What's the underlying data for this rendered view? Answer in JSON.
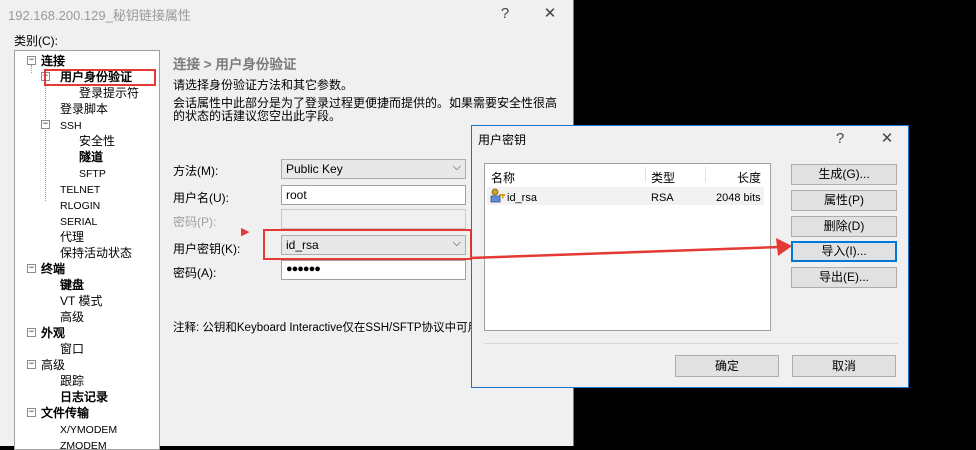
{
  "main_window": {
    "title": "192.168.200.129_秘钥链接属性",
    "help_btn": "?",
    "close_btn": "✕",
    "category_label": "类别(C):",
    "tree": {
      "connection": "连接",
      "user_auth": "用户身份验证",
      "login_prompt": "登录提示符",
      "login_script": "登录脚本",
      "ssh": "SSH",
      "security": "安全性",
      "tunnel": "隧道",
      "sftp": "SFTP",
      "telnet": "TELNET",
      "rlogin": "RLOGIN",
      "serial": "SERIAL",
      "proxy": "代理",
      "keepalive": "保持活动状态",
      "terminal": "终端",
      "keyboard": "键盘",
      "vt_mode": "VT 模式",
      "advanced_term": "高级",
      "appearance": "外观",
      "window": "窗口",
      "advanced": "高级",
      "trace": "跟踪",
      "log": "日志记录",
      "file_transfer": "文件传输",
      "xymodem": "X/YMODEM",
      "zmodem": "ZMODEM"
    },
    "section_header": "连接 > 用户身份验证",
    "desc1": "请选择身份验证方法和其它参数。",
    "desc2": "会话属性中此部分是为了登录过程更便捷而提供的。如果需要安全性很高",
    "desc3": "的状态的话建议您空出此字段。",
    "form": {
      "method_label": "方法(M):",
      "method_value": "Public Key",
      "username_label": "用户名(U):",
      "username_value": "root",
      "password_label": "密码(P):",
      "userkey_label": "用户密钥(K):",
      "userkey_value": "id_rsa",
      "passphrase_label": "密码(A):",
      "passphrase_value": "●●●●●●"
    },
    "note": "注释: 公钥和Keyboard Interactive仅在SSH/SFTP协议中可用。"
  },
  "key_dialog": {
    "title": "用户密钥",
    "help_btn": "?",
    "close_btn": "✕",
    "columns": [
      "名称",
      "类型",
      "长度"
    ],
    "rows": [
      {
        "name": "id_rsa",
        "type": "RSA",
        "length": "2048 bits"
      }
    ],
    "buttons": {
      "generate": "生成(G)...",
      "properties": "属性(P)",
      "delete": "删除(D)",
      "import": "导入(I)...",
      "export": "导出(E)..."
    },
    "ok": "确定",
    "cancel": "取消"
  },
  "colors": {
    "annotation": "#e53935",
    "focus_blue": "#0078d7"
  }
}
